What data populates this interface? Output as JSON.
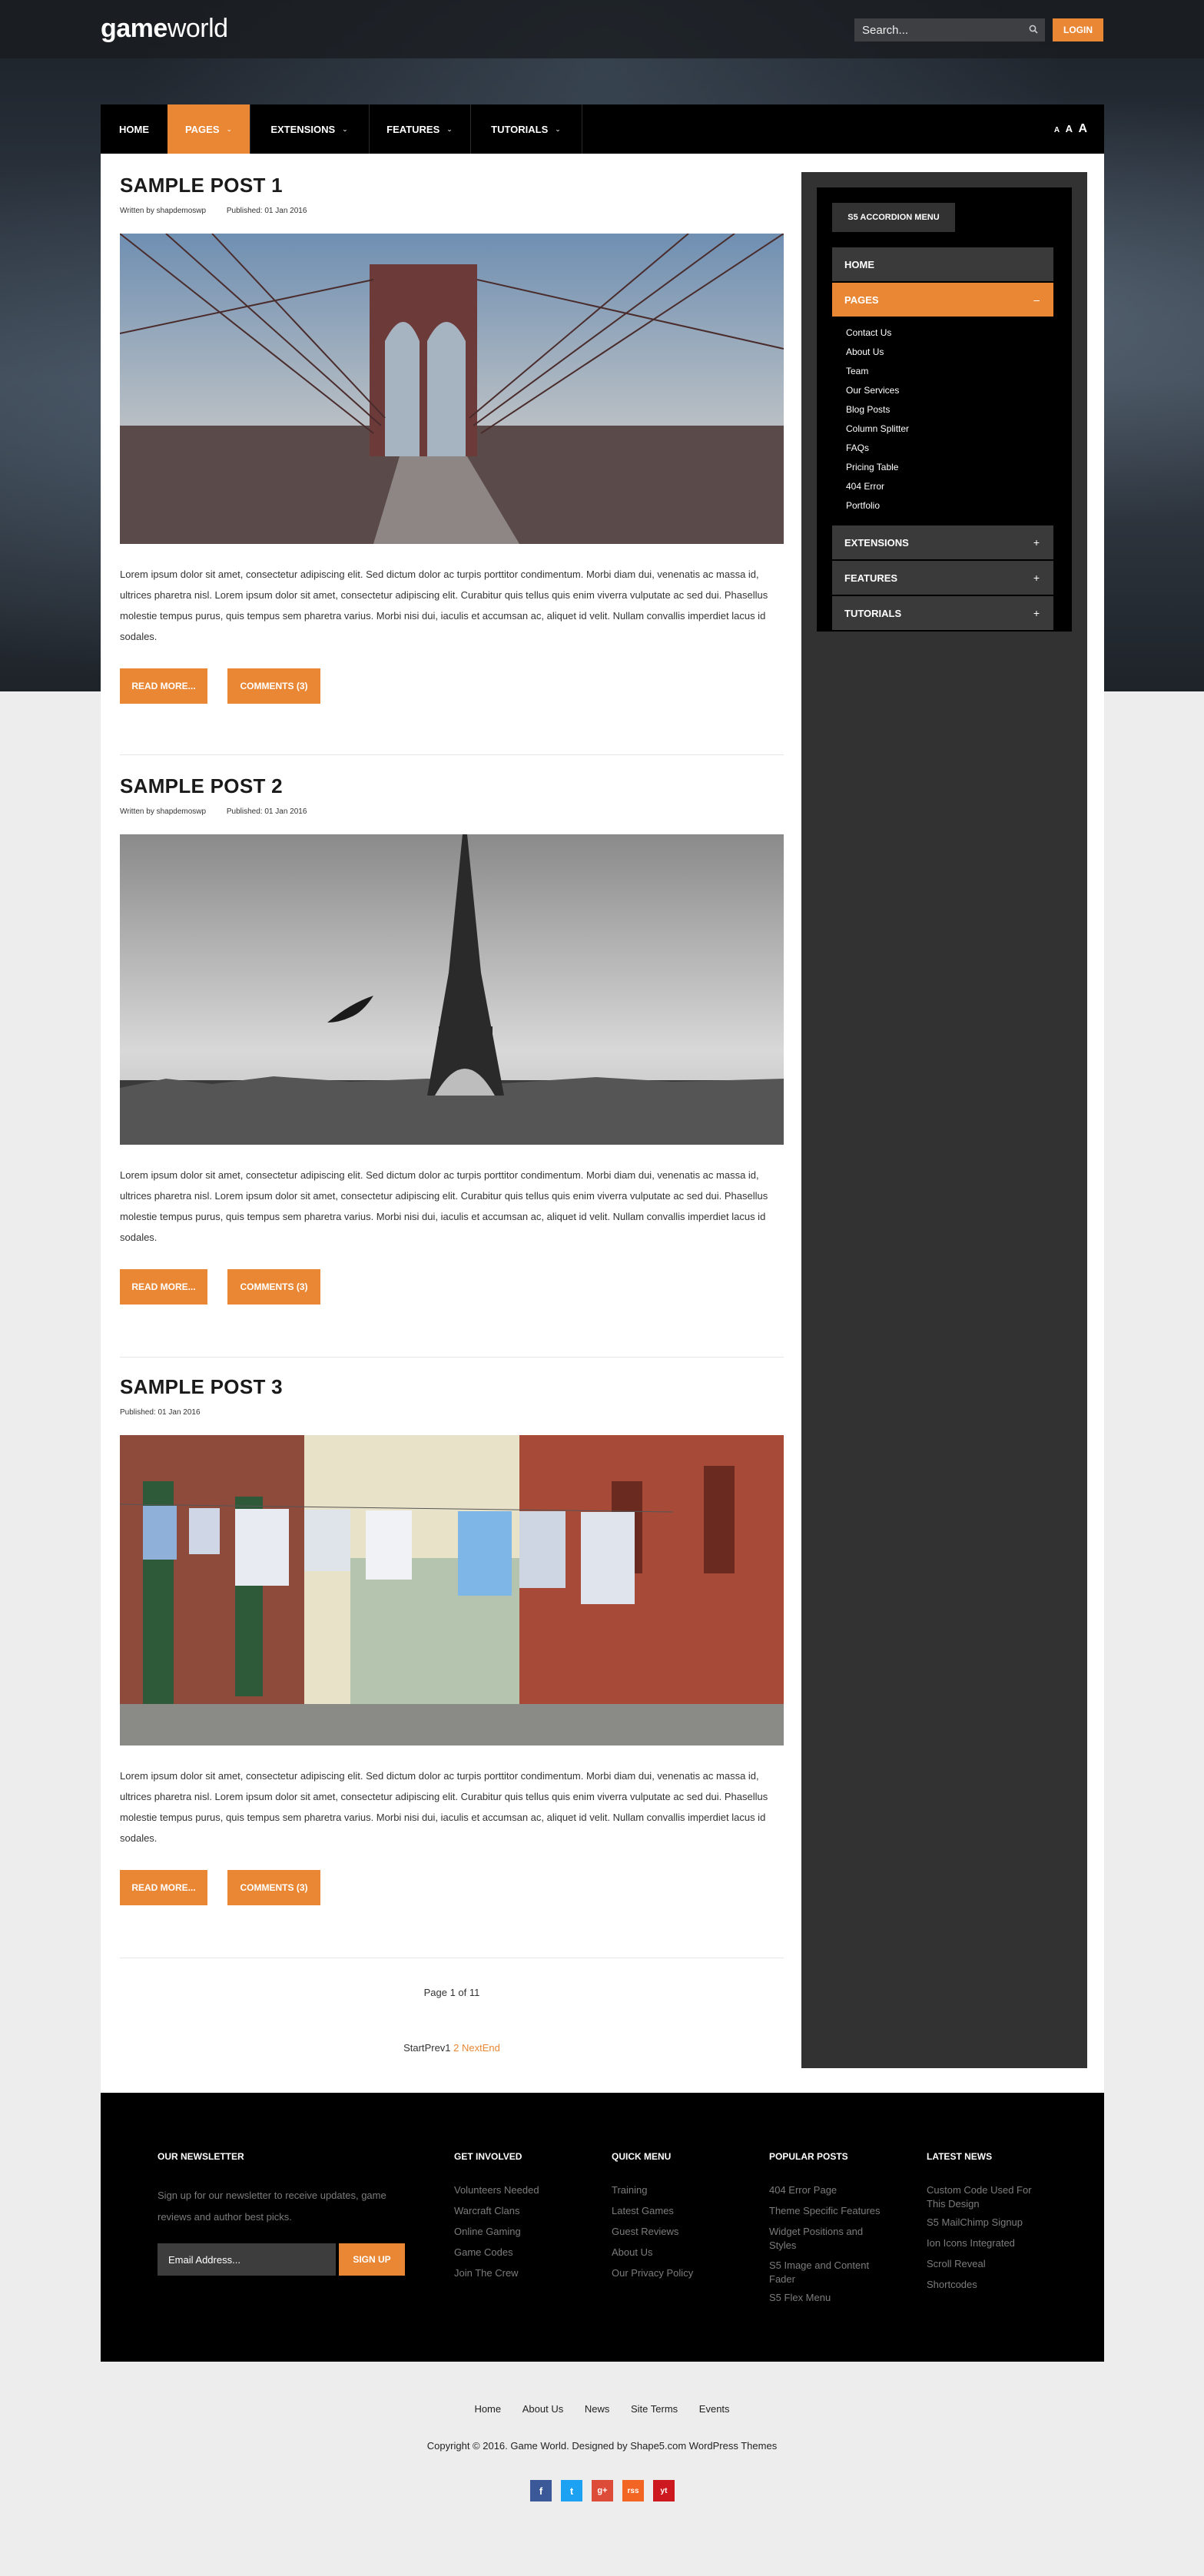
{
  "header": {
    "logo_bold": "game",
    "logo_rest": "world",
    "search_placeholder": "Search...",
    "login_label": "LOGIN"
  },
  "nav": {
    "items": [
      {
        "label": "HOME"
      },
      {
        "label": "PAGES"
      },
      {
        "label": "EXTENSIONS"
      },
      {
        "label": "FEATURES"
      },
      {
        "label": "TUTORIALS"
      }
    ],
    "font_sizes": [
      "A",
      "A",
      "A"
    ]
  },
  "posts": [
    {
      "title": "SAMPLE POST 1",
      "author": "Written by shapdemoswp",
      "published": "Published: 01 Jan 2016",
      "text": "Lorem ipsum dolor sit amet, consectetur adipiscing elit. Sed dictum dolor ac turpis porttitor condimentum. Morbi diam dui, venenatis ac massa id, ultrices pharetra nisl. Lorem ipsum dolor sit amet, consectetur adipiscing elit. Curabitur quis tellus quis enim viverra vulputate ac sed dui. Phasellus molestie tempus purus, quis tempus sem pharetra varius. Morbi nisi dui, iaculis et accumsan ac, aliquet id velit. Nullam convallis imperdiet lacus id sodales.",
      "read_more": "READ MORE...",
      "comments": "COMMENTS (3)"
    },
    {
      "title": "SAMPLE POST 2",
      "author": "Written by shapdemoswp",
      "published": "Published: 01 Jan 2016",
      "text": "Lorem ipsum dolor sit amet, consectetur adipiscing elit. Sed dictum dolor ac turpis porttitor condimentum. Morbi diam dui, venenatis ac massa id, ultrices pharetra nisl. Lorem ipsum dolor sit amet, consectetur adipiscing elit. Curabitur quis tellus quis enim viverra vulputate ac sed dui. Phasellus molestie tempus purus, quis tempus sem pharetra varius. Morbi nisi dui, iaculis et accumsan ac, aliquet id velit. Nullam convallis imperdiet lacus id sodales.",
      "read_more": "READ MORE...",
      "comments": "COMMENTS (3)"
    },
    {
      "title": "SAMPLE POST 3",
      "author": "",
      "published": "Published: 01 Jan 2016",
      "text": "Lorem ipsum dolor sit amet, consectetur adipiscing elit. Sed dictum dolor ac turpis porttitor condimentum. Morbi diam dui, venenatis ac massa id, ultrices pharetra nisl. Lorem ipsum dolor sit amet, consectetur adipiscing elit. Curabitur quis tellus quis enim viverra vulputate ac sed dui. Phasellus molestie tempus purus, quis tempus sem pharetra varius. Morbi nisi dui, iaculis et accumsan ac, aliquet id velit. Nullam convallis imperdiet lacus id sodales.",
      "read_more": "READ MORE...",
      "comments": "COMMENTS (3)"
    }
  ],
  "pagination": {
    "page_label": "Page 1 of 11",
    "start": "Start",
    "prev": "Prev",
    "current": "1",
    "next_page": "2",
    "next": "Next",
    "end": "End"
  },
  "sidebar": {
    "menu_title": "S5 ACCORDION MENU",
    "home": "HOME",
    "pages": "PAGES",
    "pages_sym": "–",
    "sub_items": [
      "Contact Us",
      "About Us",
      "Team",
      "Our Services",
      "Blog Posts",
      "Column Splitter",
      "FAQs",
      "Pricing Table",
      "404 Error",
      "Portfolio"
    ],
    "extensions": "EXTENSIONS",
    "features": "FEATURES",
    "tutorials": "TUTORIALS",
    "plus": "+"
  },
  "footer": {
    "newsletter": {
      "heading": "OUR NEWSLETTER",
      "text": "Sign up for our newsletter to receive updates, game reviews and author best picks.",
      "email_placeholder": "Email Address...",
      "signup": "SIGN UP"
    },
    "get_involved": {
      "heading": "GET INVOLVED",
      "links": [
        "Volunteers Needed",
        "Warcraft Clans",
        "Online Gaming",
        "Game Codes",
        "Join The Crew"
      ]
    },
    "quick_menu": {
      "heading": "QUICK MENU",
      "links": [
        "Training",
        "Latest Games",
        "Guest Reviews",
        "About Us",
        "Our Privacy Policy"
      ]
    },
    "popular_posts": {
      "heading": "POPULAR POSTS",
      "links": [
        "404 Error Page",
        "Theme Specific Features",
        "Widget Positions and Styles",
        "S5 Image and Content Fader",
        "S5 Flex Menu"
      ]
    },
    "latest_news": {
      "heading": "LATEST NEWS",
      "links": [
        "Custom Code Used For This Design",
        "S5 MailChimp Signup",
        "Ion Icons Integrated",
        "Scroll Reveal",
        "Shortcodes"
      ]
    }
  },
  "bottom": {
    "links": [
      "Home",
      "About Us",
      "News",
      "Site Terms",
      "Events"
    ],
    "copyright": "Copyright © 2016. Game World. Designed by Shape5.com WordPress Themes",
    "social": [
      "f",
      "t",
      "g+",
      "rss",
      "yt"
    ]
  },
  "colors": {
    "accent": "#ea8734",
    "nav": "#000000",
    "sidebar": "#323232"
  }
}
